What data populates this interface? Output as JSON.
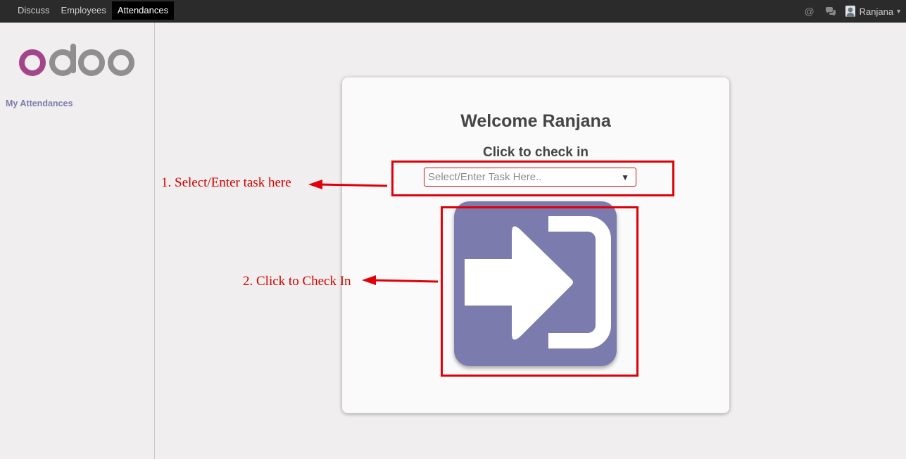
{
  "topbar": {
    "nav": [
      "Discuss",
      "Employees",
      "Attendances"
    ],
    "active_index": 2,
    "right": {
      "mention_icon": "at-icon",
      "chat_icon": "chat-bubbles-icon",
      "user_name": "Ranjana"
    }
  },
  "sidebar": {
    "logo_text": "odoo",
    "menu": [
      "My Attendances"
    ]
  },
  "card": {
    "welcome": "Welcome Ranjana",
    "checkin_label": "Click to check in",
    "task_placeholder": "Select/Enter Task Here..",
    "checkin_icon": "sign-in-icon"
  },
  "annotations": {
    "step1": "1. Select/Enter task here",
    "step2": "2. Click to Check In",
    "color": "#e0000a"
  },
  "colors": {
    "topbar": "#2b2b2b",
    "brand_purple": "#7c7bad",
    "logo_o": "#a24689",
    "logo_doo": "#8f8f8f"
  }
}
